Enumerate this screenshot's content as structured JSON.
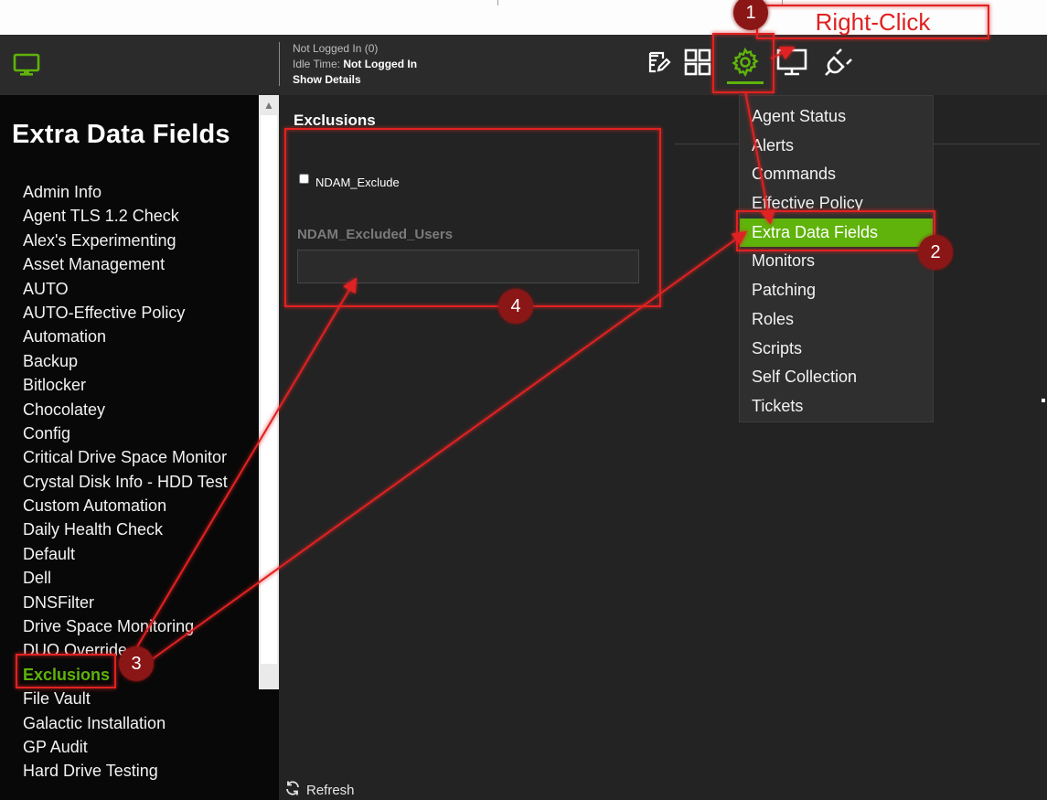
{
  "session": {
    "logged_in_label": "Not Logged In (0)",
    "idle_label": "Idle Time:",
    "idle_value": "Not Logged In",
    "details_link": "Show Details"
  },
  "sidebar": {
    "title": "Extra Data Fields",
    "items": [
      {
        "label": "Admin Info"
      },
      {
        "label": "Agent TLS 1.2 Check"
      },
      {
        "label": "Alex's Experimenting"
      },
      {
        "label": "Asset Management"
      },
      {
        "label": "AUTO"
      },
      {
        "label": "AUTO-Effective Policy"
      },
      {
        "label": "Automation"
      },
      {
        "label": "Backup"
      },
      {
        "label": "Bitlocker"
      },
      {
        "label": "Chocolatey"
      },
      {
        "label": "Config"
      },
      {
        "label": "Critical Drive Space Monitor"
      },
      {
        "label": "Crystal Disk Info - HDD Test"
      },
      {
        "label": "Custom Automation"
      },
      {
        "label": "Daily Health Check"
      },
      {
        "label": "Default"
      },
      {
        "label": "Dell"
      },
      {
        "label": "DNSFilter"
      },
      {
        "label": "Drive Space Monitoring"
      },
      {
        "label": "DUO Override"
      },
      {
        "label": "Exclusions",
        "active": true
      },
      {
        "label": "File Vault"
      },
      {
        "label": "Galactic Installation"
      },
      {
        "label": "GP Audit"
      },
      {
        "label": "Hard Drive Testing"
      }
    ]
  },
  "main": {
    "heading": "Exclusions",
    "checkbox_label": "NDAM_Exclude",
    "checkbox_checked": false,
    "users_field_label": "NDAM_Excluded_Users",
    "users_field_value": "",
    "refresh_label": "Refresh"
  },
  "context_menu": {
    "items": [
      {
        "label": "Agent Status"
      },
      {
        "label": "Alerts"
      },
      {
        "label": "Commands"
      },
      {
        "label": "Effective Policy"
      },
      {
        "label": "Extra Data Fields",
        "highlighted": true
      },
      {
        "label": "Monitors"
      },
      {
        "label": "Patching"
      },
      {
        "label": "Roles"
      },
      {
        "label": "Scripts"
      },
      {
        "label": "Self Collection"
      },
      {
        "label": "Tickets"
      }
    ]
  },
  "annotations": {
    "right_click_label": "Right-Click",
    "badges": [
      "1",
      "2",
      "3",
      "4"
    ],
    "color": "#e02020",
    "badge_fill": "#8b1414"
  },
  "colors": {
    "accent_green": "#5fb30b",
    "header_bg": "#2b2b2b",
    "sidebar_bg": "#080808",
    "main_bg": "#232323",
    "menu_bg": "#2f2f2f"
  },
  "icons": {
    "app_logo": "monitor-icon",
    "toolbar": [
      "edit-note-icon",
      "grid-icon",
      "gear-icon",
      "desktop-icon",
      "plug-icon"
    ]
  }
}
